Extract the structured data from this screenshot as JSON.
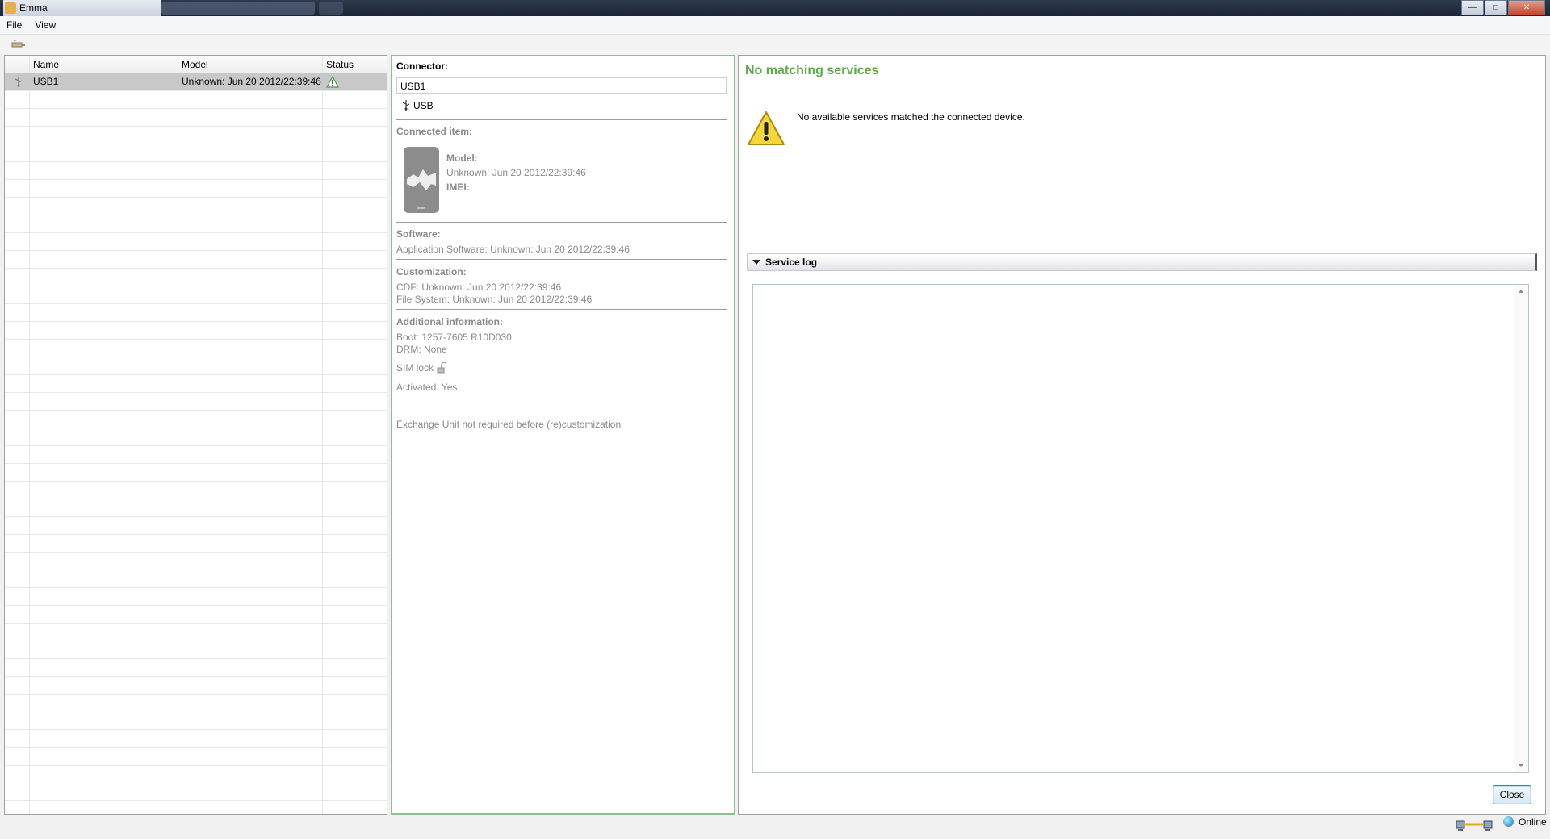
{
  "window": {
    "title": "Emma"
  },
  "menu": {
    "items": [
      {
        "label": "File"
      },
      {
        "label": "View"
      }
    ]
  },
  "list": {
    "columns": [
      {
        "label": "Name"
      },
      {
        "label": "Model"
      },
      {
        "label": "Status"
      }
    ],
    "rows": [
      {
        "name": "USB1",
        "model": "Unknown: Jun 20 2012/22:39:46",
        "status_icon": "warning-icon"
      }
    ]
  },
  "detail": {
    "connector_label": "Connector:",
    "connector_value": "USB1",
    "connector_type": "USB",
    "connected_item_label": "Connected item:",
    "model_label": "Model:",
    "model_value": "Unknown: Jun 20 2012/22:39:46",
    "imei_label": "IMEI:",
    "software_label": "Software:",
    "software_value": "Application Software: Unknown: Jun 20 2012/22:39:46",
    "customization_label": "Customization:",
    "cdf_value": "CDF: Unknown: Jun 20 2012/22:39:46",
    "fs_value": "File System: Unknown: Jun 20 2012/22:39:46",
    "additional_label": "Additional information:",
    "boot_value": "Boot: 1257-7605 R10D030",
    "drm_value": "DRM: None",
    "simlock_value": "SIM lock",
    "activated_value": "Activated: Yes",
    "exchange_value": "Exchange Unit not required before (re)customization"
  },
  "services": {
    "title": "No matching services",
    "message": "No available services matched the connected device.",
    "log_header": "Service log",
    "close_label": "Close"
  },
  "status": {
    "online_label": "Online"
  },
  "colors": {
    "accent_green": "#5eaa4a",
    "selection_gray": "#c8c8c8"
  }
}
